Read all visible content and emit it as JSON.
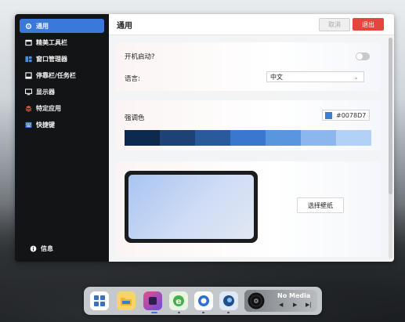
{
  "sidebar": {
    "items": [
      {
        "label": "通用",
        "icon": "gear-icon"
      },
      {
        "label": "精美工具栏",
        "icon": "toolbar-icon"
      },
      {
        "label": "窗口管理器",
        "icon": "window-manager-icon"
      },
      {
        "label": "停靠栏/任务栏",
        "icon": "dock-icon"
      },
      {
        "label": "显示器",
        "icon": "monitor-icon"
      },
      {
        "label": "特定应用",
        "icon": "layers-icon"
      },
      {
        "label": "快捷键",
        "icon": "keyboard-icon"
      }
    ],
    "footer_label": "信息"
  },
  "header": {
    "title": "通用",
    "cancel_label": "取消",
    "exit_label": "退出"
  },
  "general": {
    "autostart_label": "开机启动?",
    "autostart_on": false,
    "language_label": "语言:",
    "language_value": "中文"
  },
  "accent": {
    "label": "强调色",
    "value": "#0078D7",
    "swatch": "#3b7fd4",
    "palette": [
      "#0d2a4d",
      "#1e4273",
      "#2a5a9b",
      "#3a78cf",
      "#5a96e0",
      "#8bb6ee",
      "#b3d0f6"
    ]
  },
  "wallpaper": {
    "button_label": "选择壁纸"
  },
  "dock": {
    "apps": [
      "start-grid-icon",
      "file-explorer-icon",
      "color-app-icon",
      "edge-browser-icon",
      "circle-app-icon",
      "steam-like-icon"
    ],
    "media_title": "No Media",
    "media_prev": "◀",
    "media_play": "▶",
    "media_next": "▶|"
  }
}
